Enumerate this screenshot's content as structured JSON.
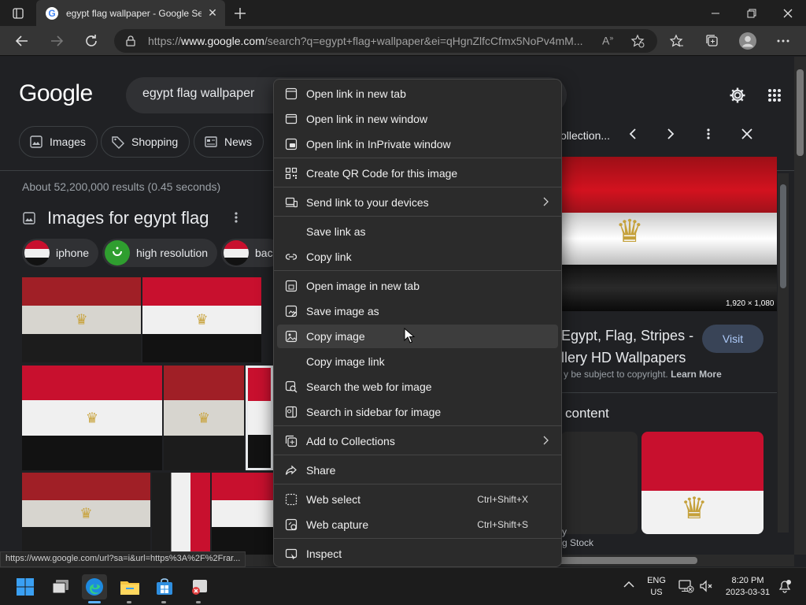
{
  "browser": {
    "tab_title": "egypt flag wallpaper - Google Se",
    "tab_favicon": "G",
    "url_scheme": "https://",
    "url_host": "www.google.com",
    "url_rest": "/search?q=egypt+flag+wallpaper&ei=qHgnZlfcCfmx5NoPv4mM..."
  },
  "google": {
    "logo": "Google",
    "query": "egypt flag wallpaper",
    "chips": [
      "Images",
      "Shopping",
      "News"
    ],
    "results_stats": "About 52,200,000 results (0.45 seconds)",
    "images_heading": "Images for egypt flag",
    "refinements": [
      "iphone",
      "high resolution",
      "bac"
    ]
  },
  "side_panel": {
    "collection_label": "ollection...",
    "image_size": "1,920 × 1,080",
    "title_line1": "Egypt, Flag, Stripes -",
    "title_line2": "llery HD Wallpapers",
    "visit_label": "Visit",
    "copyright_text": "y be subject to copyright.",
    "learn_more": "Learn More",
    "related_heading": "content",
    "related_caption": "y",
    "related_caption2": "g Stock"
  },
  "status_url": "https://www.google.com/url?sa=i&url=https%3A%2F%2Frar...",
  "context_menu": {
    "items": [
      {
        "label": "Open link in new tab",
        "icon": "new-tab-icon"
      },
      {
        "label": "Open link in new window",
        "icon": "window-icon"
      },
      {
        "label": "Open link in InPrivate window",
        "icon": "inprivate-icon"
      },
      {
        "label": "Create QR Code for this image",
        "icon": "qr-code-icon"
      },
      {
        "label": "Send link to your devices",
        "icon": "devices-icon"
      },
      {
        "label": "Save link as",
        "icon": ""
      },
      {
        "label": "Copy link",
        "icon": "link-icon"
      },
      {
        "label": "Open image in new tab",
        "icon": "image-new-tab-icon"
      },
      {
        "label": "Save image as",
        "icon": "save-image-icon"
      },
      {
        "label": "Copy image",
        "icon": "copy-image-icon"
      },
      {
        "label": "Copy image link",
        "icon": ""
      },
      {
        "label": "Search the web for image",
        "icon": "search-image-icon"
      },
      {
        "label": "Search in sidebar for image",
        "icon": "sidebar-search-icon"
      },
      {
        "label": "Add to Collections",
        "icon": "collections-icon"
      },
      {
        "label": "Share",
        "icon": "share-icon"
      },
      {
        "label": "Web select",
        "icon": "web-select-icon",
        "shortcut": "Ctrl+Shift+X"
      },
      {
        "label": "Web capture",
        "icon": "web-capture-icon",
        "shortcut": "Ctrl+Shift+S"
      },
      {
        "label": "Inspect",
        "icon": "inspect-icon"
      }
    ]
  },
  "taskbar": {
    "lang_line1": "ENG",
    "lang_line2": "US",
    "time": "8:20 PM",
    "date": "2023-03-31"
  },
  "colors": {
    "flag_red": "#c8102e",
    "flag_white": "#f0f0f0",
    "flag_black": "#121212",
    "menu_bg": "#2b2b2b",
    "page_bg": "#202124"
  }
}
